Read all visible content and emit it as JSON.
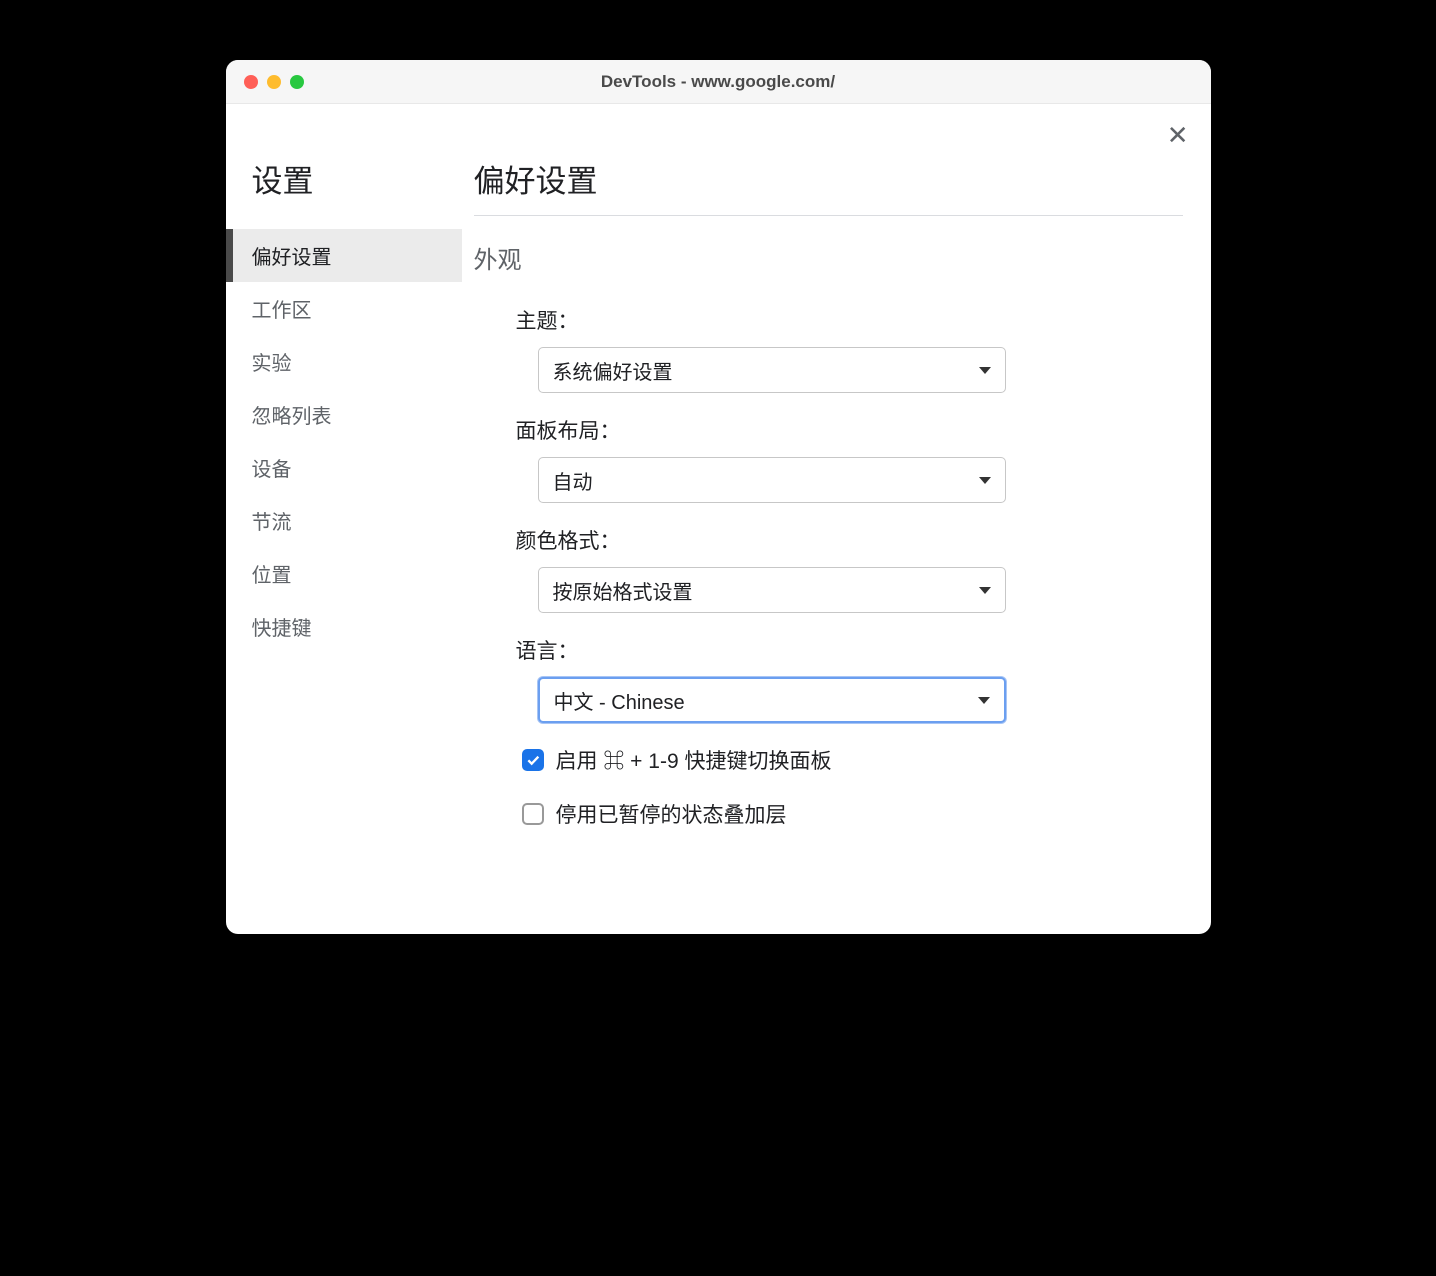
{
  "window": {
    "title": "DevTools - www.google.com/"
  },
  "sidebar": {
    "title": "设置",
    "items": [
      {
        "label": "偏好设置",
        "active": true
      },
      {
        "label": "工作区",
        "active": false
      },
      {
        "label": "实验",
        "active": false
      },
      {
        "label": "忽略列表",
        "active": false
      },
      {
        "label": "设备",
        "active": false
      },
      {
        "label": "节流",
        "active": false
      },
      {
        "label": "位置",
        "active": false
      },
      {
        "label": "快捷键",
        "active": false
      }
    ]
  },
  "page": {
    "heading": "偏好设置",
    "section_title": "外观",
    "fields": {
      "theme": {
        "label": "主题：",
        "value": "系统偏好设置"
      },
      "panel_layout": {
        "label": "面板布局：",
        "value": "自动"
      },
      "color_format": {
        "label": "颜色格式：",
        "value": "按原始格式设置"
      },
      "language": {
        "label": "语言：",
        "value": "中文 - Chinese"
      }
    },
    "checkboxes": {
      "enable_shortcuts": {
        "label": "启用 ⌘ + 1-9 快捷键切换面板",
        "checked": true
      },
      "disable_overlay": {
        "label": "停用已暂停的状态叠加层",
        "checked": false
      }
    }
  }
}
